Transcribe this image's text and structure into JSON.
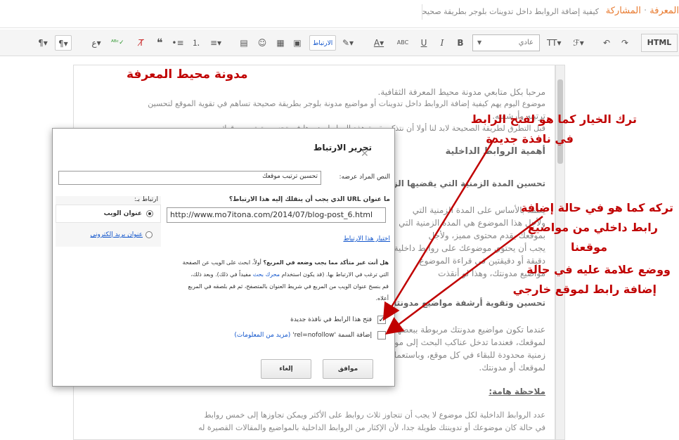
{
  "header": {
    "breadcrumb_part1": "المعرفة",
    "breadcrumb_sep": "·",
    "breadcrumb_part2": "المشاركة",
    "post_title": "كيفية إضافة الروابط داخل تدوينات بلوجر بطريقة صحيحة"
  },
  "toolbar": {
    "html_label": "HTML",
    "font_select": "عادي",
    "items": [
      {
        "name": "redo-icon",
        "glyph": "↷"
      },
      {
        "name": "undo-icon",
        "glyph": "↶"
      },
      {
        "name": "font-family-icon",
        "glyph": "ℱ▾"
      },
      {
        "name": "font-size-icon",
        "glyph": "TT▾"
      },
      {
        "name": "bold-icon",
        "glyph": "B"
      },
      {
        "name": "italic-icon",
        "glyph": "I"
      },
      {
        "name": "underline-icon",
        "glyph": "U"
      },
      {
        "name": "strikethrough-icon",
        "glyph": "ABC"
      },
      {
        "name": "text-color-icon",
        "glyph": "A▾"
      },
      {
        "name": "highlight-icon",
        "glyph": "✎▾"
      },
      {
        "name": "link-button",
        "glyph": "الارتباط"
      },
      {
        "name": "image-icon",
        "glyph": "▣"
      },
      {
        "name": "video-icon",
        "glyph": "▦"
      },
      {
        "name": "emoji-icon",
        "glyph": "☺"
      },
      {
        "name": "jump-break-icon",
        "glyph": "▤"
      },
      {
        "name": "align-icon",
        "glyph": "≡▾"
      },
      {
        "name": "numbered-list-icon",
        "glyph": "⒈"
      },
      {
        "name": "bullet-list-icon",
        "glyph": "•≡"
      },
      {
        "name": "quote-icon",
        "glyph": "❝"
      },
      {
        "name": "clear-format-icon",
        "glyph": "T̸"
      },
      {
        "name": "spellcheck-icon",
        "glyph": "ᴬᴮᶜ✓"
      },
      {
        "name": "input-tools-icon",
        "glyph": "ع▾"
      },
      {
        "name": "rtl-icon",
        "glyph": "¶▾"
      },
      {
        "name": "ltr-icon",
        "glyph": "¶▾"
      }
    ]
  },
  "editor": {
    "blog_heading": "مدونة محيط المعرفة",
    "line1": "مرحبا بكل متابعي مدونة محيط المعرفة الثقافية.",
    "line2": "موضوع اليوم يهم كيفية إضافة الروابط داخل تدوينات أو مواضيع مدونة بلوجر بطريقة صحيحة تساهم في تقوية الموقع لتحسين",
    "line3": "ترتيبه وأرشفته.",
    "line4": "قبل التطرق لطريقة الصحيحة لابد لنا أولا أن نتذكر بقيمة هذه الروابط ودورها في تحسين ترتيب موقعك.",
    "h_importance": "أهمية الروابط الداخلية",
    "h_time": "تحسين المدة الزمنية التي يقضيها الزائر بموقعك",
    "p_time1": "يعتمد بالأساس على المدة الزمنية التي",
    "p_time2": "ولأجل هذا الموضوع هي المدة الزمنية التي",
    "p_time3": "بموقعك يقدم محتوى مميز، ولأجل",
    "p_time4": "يجب أن يحتوي موضوعك على روابط داخلية",
    "p_time5": "دقيقة أو دقيقتين في قراءة الموضوع",
    "p_time6": "مواضيع مدونتك، وهذا لو أنقذت",
    "h_index": "تحسين وتقوية أرشفة مواضيع مدونتك",
    "p_index1": "عندما تكون مواضيع مدونتك مربوطة ببعضها البعض",
    "p_index2": "لموقعك، فعندما تدخل عناكب البحث إلى موقعك",
    "p_index3": "زمنية محدودة للبقاء في كل موقع، وباستعمال",
    "p_index4": "لموقعك أو مدونتك.",
    "note_heading": "ملاحظة هامة:",
    "note1": "عدد الروابط الداخلية لكل موضوع لا يجب أن تتجاوز ثلاث روابط على الأكثر ويمكن تجاوزها إلى خمس روابط",
    "note2": "في حالة كان موضوعك أو تدوينتك طويلة جدا، لأن الإكثار من الروابط الداخلية بالمواضيع والمقالات القصيرة له"
  },
  "dialog": {
    "title": "تحرير الارتباط",
    "close": "✕",
    "display_label": "النص المراد عرضه:",
    "display_value": "تحسين ترتيب موقعك",
    "link_to_label": "ارتباط بـ:",
    "opt_web": "عنوان الويب",
    "opt_email": "عنوان بريد إلكتروني",
    "url_question": "ما عنوان URL الذي يجب أن ينقلك إليه هذا الارتباط؟",
    "url_value": "http://www.mo7itona.com/2014/07/blog-post_6.html",
    "test_link": "اختبار هذا الارتباط",
    "help_bold": "هل أنت غير متأكد مما يجب وضعه في المربع؟",
    "help1": "أولاً، ابحث على الويب عن الصفحة",
    "help2": "التي ترغب في الارتباط بها. (قد يكون استخدام",
    "help2_link": "محرك بحث",
    "help2b": "مفيداً في ذلك). وبعد ذلك،",
    "help3": "قم بنسخ عنوان الويب من المربع في شريط العنوان بالمتصفح، ثم قم بلصقه في المربع",
    "help4": "أعلاه.",
    "cb_newwin": "فتح هذا الرابط في نافذة جديدة",
    "cb_nofollow_pre": "إضافة السمة 'rel=nofollow'",
    "cb_nofollow_link": "(مزيد من المعلومات)",
    "btn_ok": "موافق",
    "btn_cancel": "إلغاء"
  },
  "annotations": {
    "a1_l1": "ترك الخيار كما هو لفتح الرابط",
    "a1_l2": "في نافذة جديدة",
    "a2_l1": "تركه كما هو في حالة إضافة",
    "a2_l2": "رابط داخلي من مواضيع",
    "a2_l3": "موقعنا",
    "a2_l4": "ووضع علامة عليه في حالة",
    "a2_l5": "إضافة رابط لموقع  خارجي",
    "color": "#c00000"
  }
}
